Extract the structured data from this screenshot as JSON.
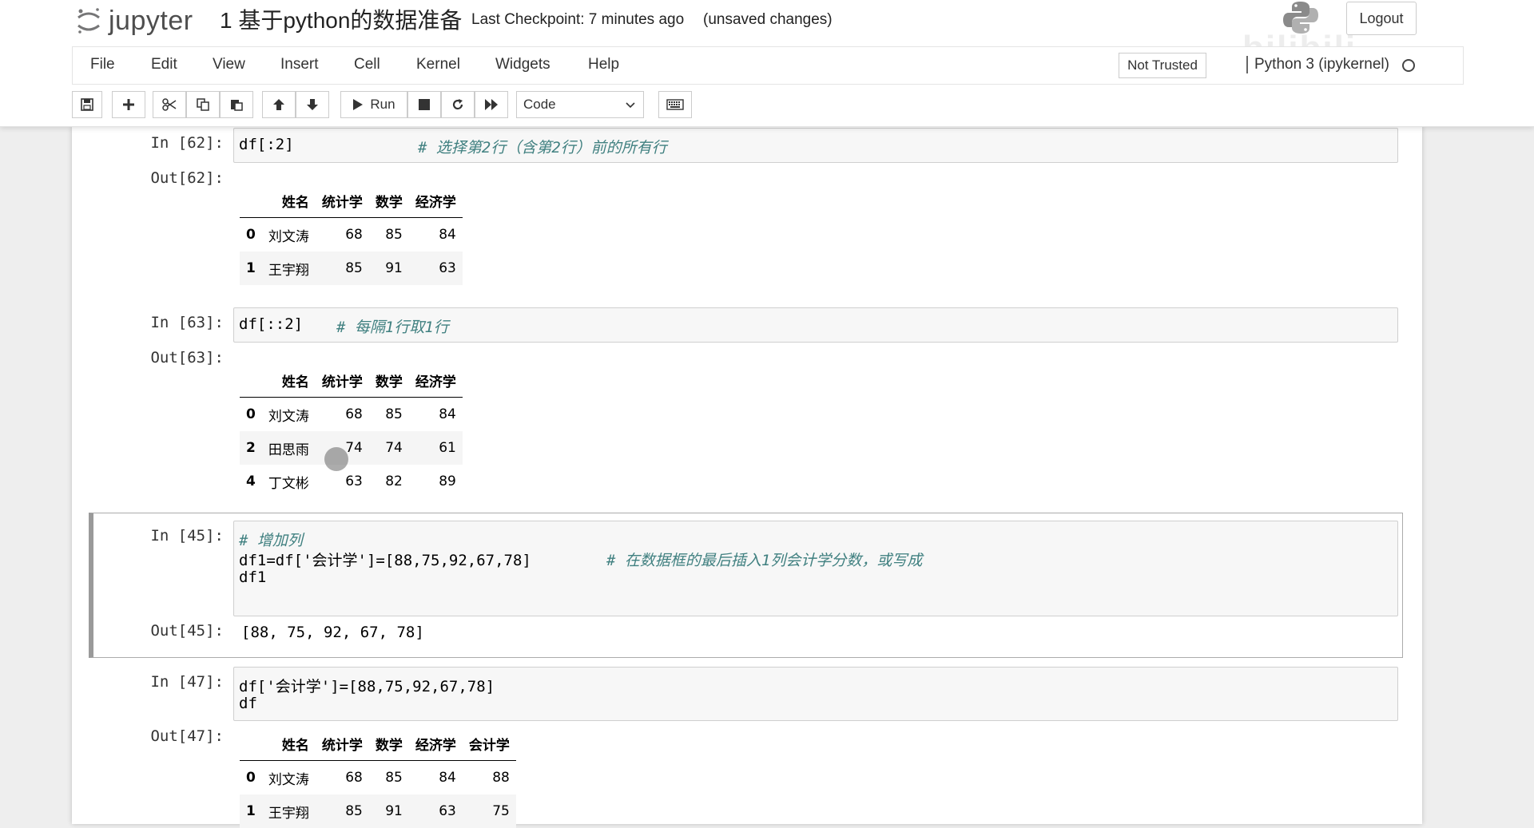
{
  "header": {
    "logo_text": "jupyter",
    "notebook_title": "1 基于python的数据准备",
    "checkpoint": "Last Checkpoint: 7 minutes ago",
    "unsaved": "(unsaved changes)",
    "logout": "Logout",
    "watermark": "bilibili"
  },
  "menubar": {
    "items": [
      "File",
      "Edit",
      "View",
      "Insert",
      "Cell",
      "Kernel",
      "Widgets",
      "Help"
    ],
    "trust": "Not Trusted",
    "kernel": "Python 3 (ipykernel)"
  },
  "toolbar": {
    "run_label": "Run",
    "cell_type": "Code",
    "icons": [
      "save-icon",
      "plus-icon",
      "cut-icon",
      "copy-icon",
      "paste-icon",
      "arrow-up-icon",
      "arrow-down-icon",
      "play-icon",
      "stop-icon",
      "restart-icon",
      "fast-forward-icon",
      "keyboard-icon"
    ]
  },
  "cells": [
    {
      "in_prompt": "In [62]:",
      "code_lines": [
        {
          "code": "df[:2]",
          "comment": "# 选择第2行（含第2行）前的所有行"
        }
      ],
      "out_prompt": "Out[62]:",
      "table": {
        "columns": [
          "",
          "姓名",
          "统计学",
          "数学",
          "经济学"
        ],
        "rows": [
          [
            "0",
            "刘文涛",
            "68",
            "85",
            "84"
          ],
          [
            "1",
            "王宇翔",
            "85",
            "91",
            "63"
          ]
        ]
      }
    },
    {
      "in_prompt": "In [63]:",
      "code_lines": [
        {
          "code": "df[::2]",
          "comment": "# 每隔1行取1行"
        }
      ],
      "out_prompt": "Out[63]:",
      "table": {
        "columns": [
          "",
          "姓名",
          "统计学",
          "数学",
          "经济学"
        ],
        "rows": [
          [
            "0",
            "刘文涛",
            "68",
            "85",
            "84"
          ],
          [
            "2",
            "田思雨",
            "74",
            "74",
            "61"
          ],
          [
            "4",
            "丁文彬",
            "63",
            "82",
            "89"
          ]
        ]
      }
    },
    {
      "in_prompt": "In [45]:",
      "code_lines": [
        {
          "code": "",
          "comment": "# 增加列"
        },
        {
          "code": "df1=df['会计学']=[88,75,92,67,78]",
          "comment": "# 在数据框的最后插入1列会计学分数，或写成"
        },
        {
          "code": "df1",
          "comment": ""
        }
      ],
      "out_prompt": "Out[45]:",
      "output_text": "[88, 75, 92, 67, 78]"
    },
    {
      "in_prompt": "In [47]:",
      "code_lines": [
        {
          "code": "df['会计学']=[88,75,92,67,78]",
          "comment": ""
        },
        {
          "code": "df",
          "comment": ""
        }
      ],
      "out_prompt": "Out[47]:",
      "table": {
        "columns": [
          "",
          "姓名",
          "统计学",
          "数学",
          "经济学",
          "会计学"
        ],
        "rows": [
          [
            "0",
            "刘文涛",
            "68",
            "85",
            "84",
            "88"
          ],
          [
            "1",
            "王宇翔",
            "85",
            "91",
            "63",
            "75"
          ]
        ]
      }
    }
  ]
}
